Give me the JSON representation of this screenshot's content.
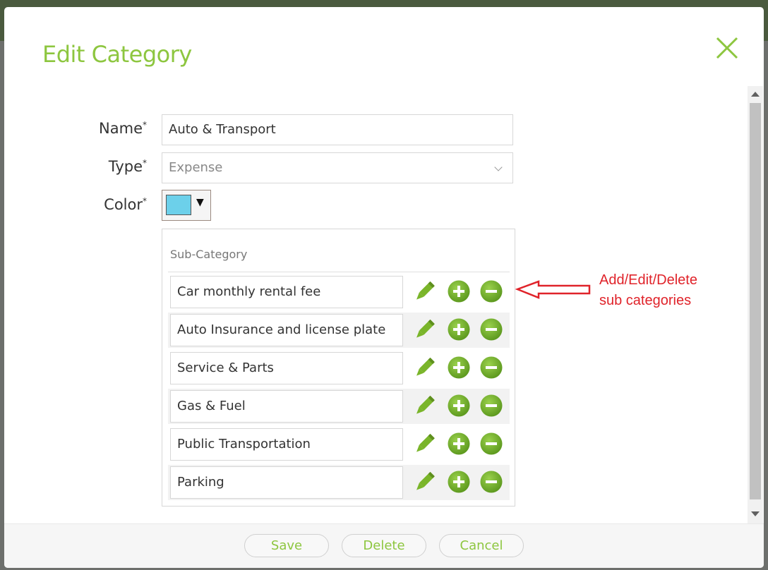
{
  "dialog": {
    "title": "Edit Category"
  },
  "form": {
    "name_label": "Name",
    "type_label": "Type",
    "color_label": "Color",
    "required_mark": "*",
    "name_value": "Auto & Transport",
    "type_value": "Expense",
    "color_value": "#6cd0ea"
  },
  "subcategory": {
    "header": "Sub-Category",
    "items": [
      "Car monthly rental fee",
      "Auto Insurance and license plate",
      "Service & Parts",
      "Gas & Fuel",
      "Public Transportation",
      "Parking"
    ]
  },
  "annotation": {
    "line1": "Add/Edit/Delete",
    "line2": "sub categories",
    "color": "#e0232a"
  },
  "footer": {
    "save_label": "Save",
    "delete_label": "Delete",
    "cancel_label": "Cancel"
  },
  "colors": {
    "accent": "#8dc63f",
    "icon_green": "#6aa826"
  },
  "icons": {
    "close": "close-icon",
    "edit": "pencil-icon",
    "add": "plus-circle-icon",
    "remove": "minus-circle-icon",
    "dropdown": "chevron-down-icon"
  }
}
